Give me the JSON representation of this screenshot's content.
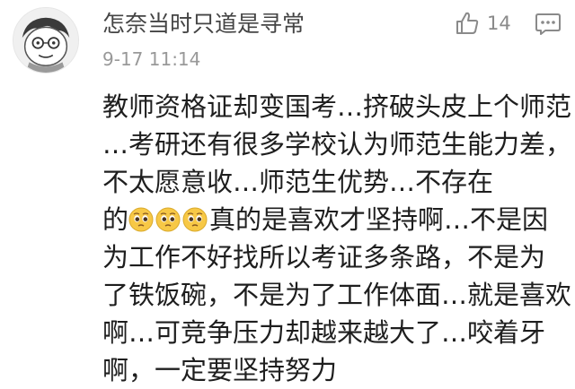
{
  "comment": {
    "username": "怎奈当时只道是寻常",
    "timestamp": "9-17 11:14",
    "like_count": "14",
    "avatar_icon": "cartoon-face-avatar",
    "like_icon": "thumbs-up-icon",
    "reply_icon": "speech-bubble-icon",
    "emoji_icon": "pleading-face-emoji",
    "lines": [
      "教师资格证却变国考…挤破头皮上个师范",
      "…考研还有很多学校认为师范生能力差，",
      "不太愿意收…师范生优势…不存在",
      "真的是喜欢才坚持啊…不是因",
      "为工作不好找所以考证多条路，不是为",
      "了铁饭碗，不是为了工作体面…就是喜欢",
      "啊…可竞争压力却越来越大了…咬着牙",
      "啊，一定要坚持努力"
    ],
    "line4_prefix": "的",
    "colors": {
      "username": "#444444",
      "timestamp": "#999999",
      "icon": "#8a8a8a",
      "text": "#1e1e1e",
      "emoji": "#f7c846"
    }
  }
}
